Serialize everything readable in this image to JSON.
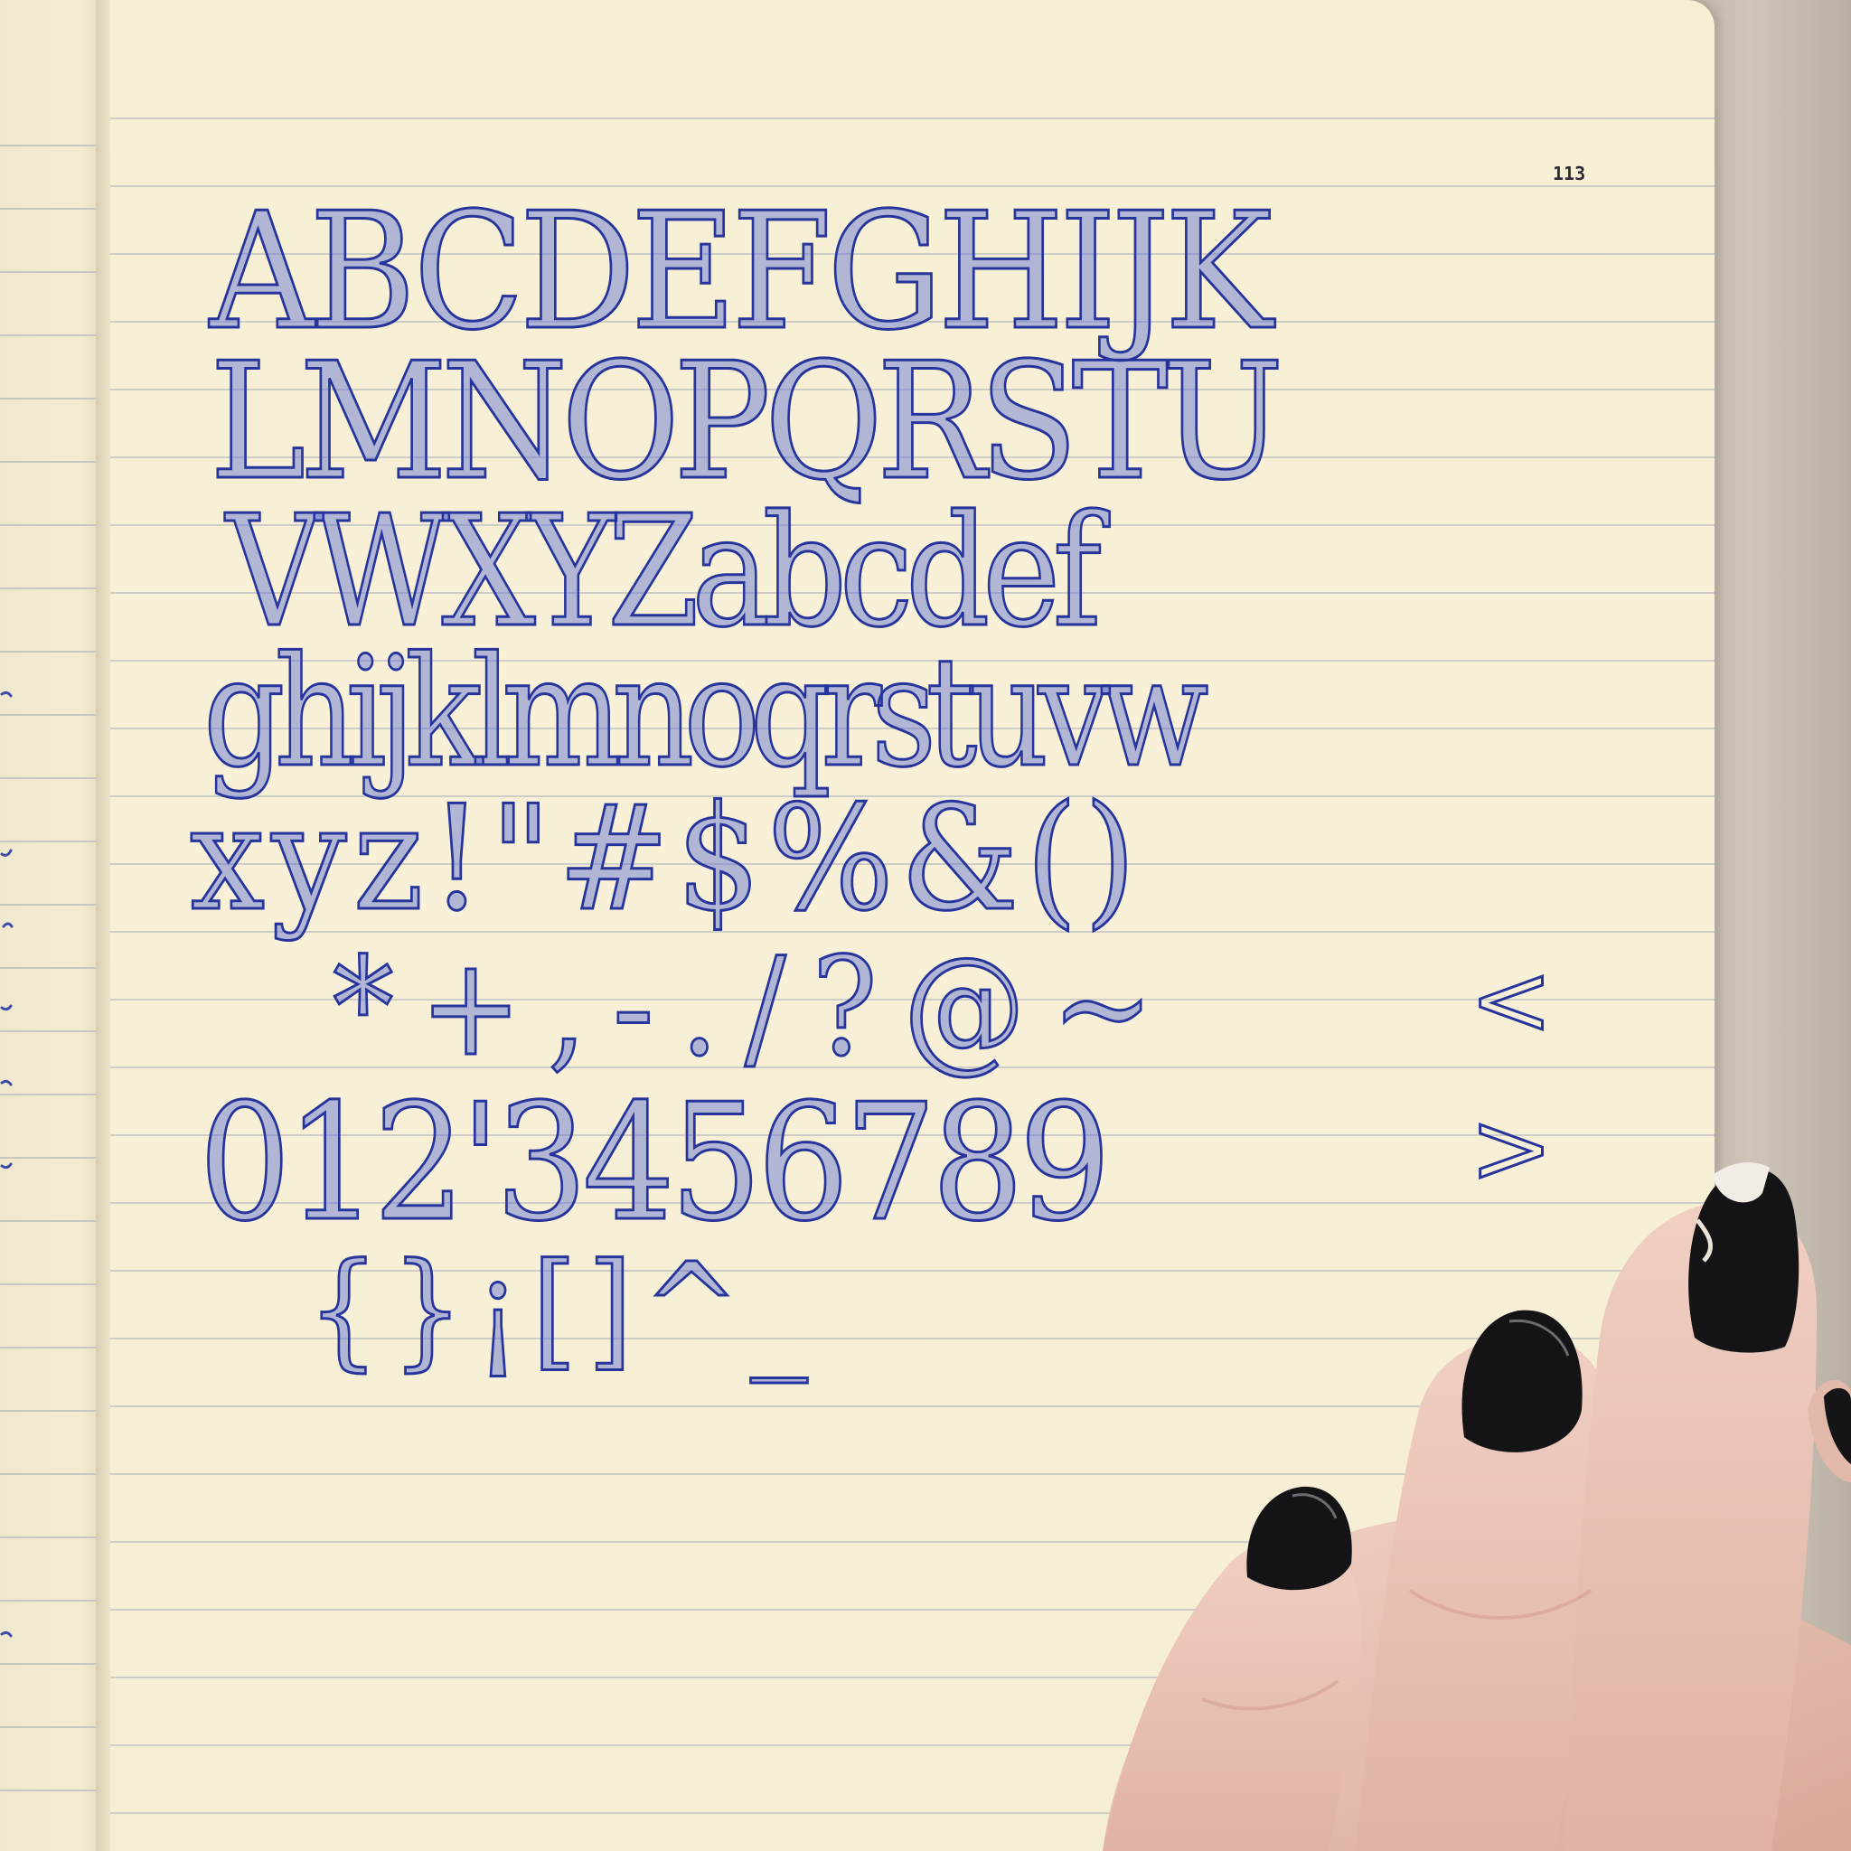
{
  "page": {
    "number": "113"
  },
  "specimen": {
    "rows": [
      "ABCDEFGHIJK",
      "LMNOPQRSTU",
      "VWXYZabcdef",
      "ghijklmnoqrstuvw",
      "xyz!\"#$%&()",
      "*+,-./?@~",
      "012'3456789",
      "{}¡[]^_"
    ],
    "less_than": "<",
    "greater_than": ">"
  },
  "colors": {
    "ink": "#26349b",
    "paper": "#f7f0d6",
    "rule_line": "#cfcdc8",
    "nail_polish": "#16161a",
    "skin": "#ecc8bd"
  }
}
